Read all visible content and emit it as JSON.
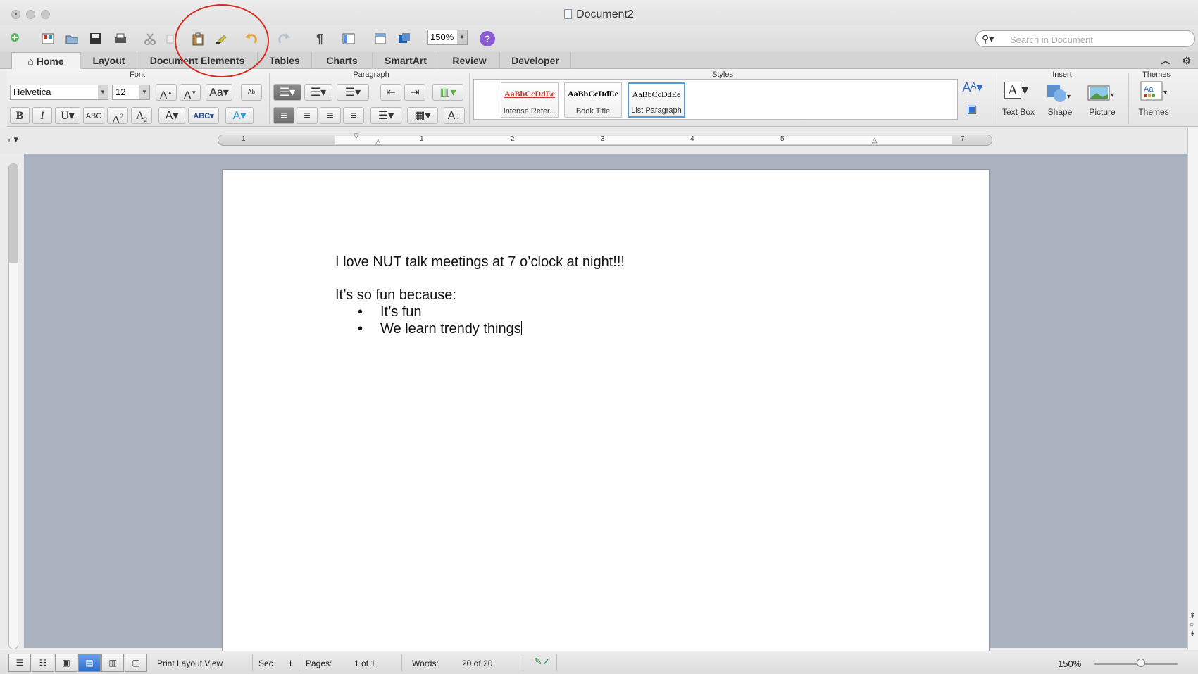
{
  "window": {
    "title": "Document2"
  },
  "toolbar": {
    "zoom": "150%",
    "search_placeholder": "Search in Document",
    "help": "?"
  },
  "tabs": [
    {
      "label": "Home",
      "active": true
    },
    {
      "label": "Layout"
    },
    {
      "label": "Document Elements"
    },
    {
      "label": "Tables"
    },
    {
      "label": "Charts"
    },
    {
      "label": "SmartArt"
    },
    {
      "label": "Review"
    },
    {
      "label": "Developer"
    }
  ],
  "ribbon": {
    "groups": {
      "font": "Font",
      "paragraph": "Paragraph",
      "styles": "Styles",
      "insert": "Insert",
      "themes": "Themes"
    },
    "font_name": "Helvetica",
    "font_size": "12",
    "styles": [
      {
        "sample": "AaBbCcDdEe",
        "name": "Intense Refer...",
        "color": "#c0392b"
      },
      {
        "sample": "AaBbCcDdEe",
        "name": "Book Title",
        "color": "#222222"
      },
      {
        "sample": "AaBbCcDdEe",
        "name": "List Paragraph",
        "color": "#333333",
        "selected": true
      }
    ],
    "insert": {
      "text_box": "Text Box",
      "shape": "Shape",
      "picture": "Picture",
      "themes": "Themes"
    }
  },
  "ruler": {
    "numbers": [
      "1",
      "1",
      "2",
      "3",
      "4",
      "5",
      "7"
    ]
  },
  "document": {
    "line1": "I love NUT talk meetings at 7 o’clock at night!!!",
    "line2": "It’s so fun because:",
    "bullets": [
      "It’s fun",
      "We learn trendy things"
    ]
  },
  "status": {
    "view": "Print Layout View",
    "sec_label": "Sec",
    "sec_value": "1",
    "pages_label": "Pages:",
    "pages_value": "1 of 1",
    "words_label": "Words:",
    "words_value": "20 of 20",
    "zoom": "150%"
  },
  "colors": {
    "annotation": "#d62a1f",
    "accent": "#2f6dcc"
  }
}
